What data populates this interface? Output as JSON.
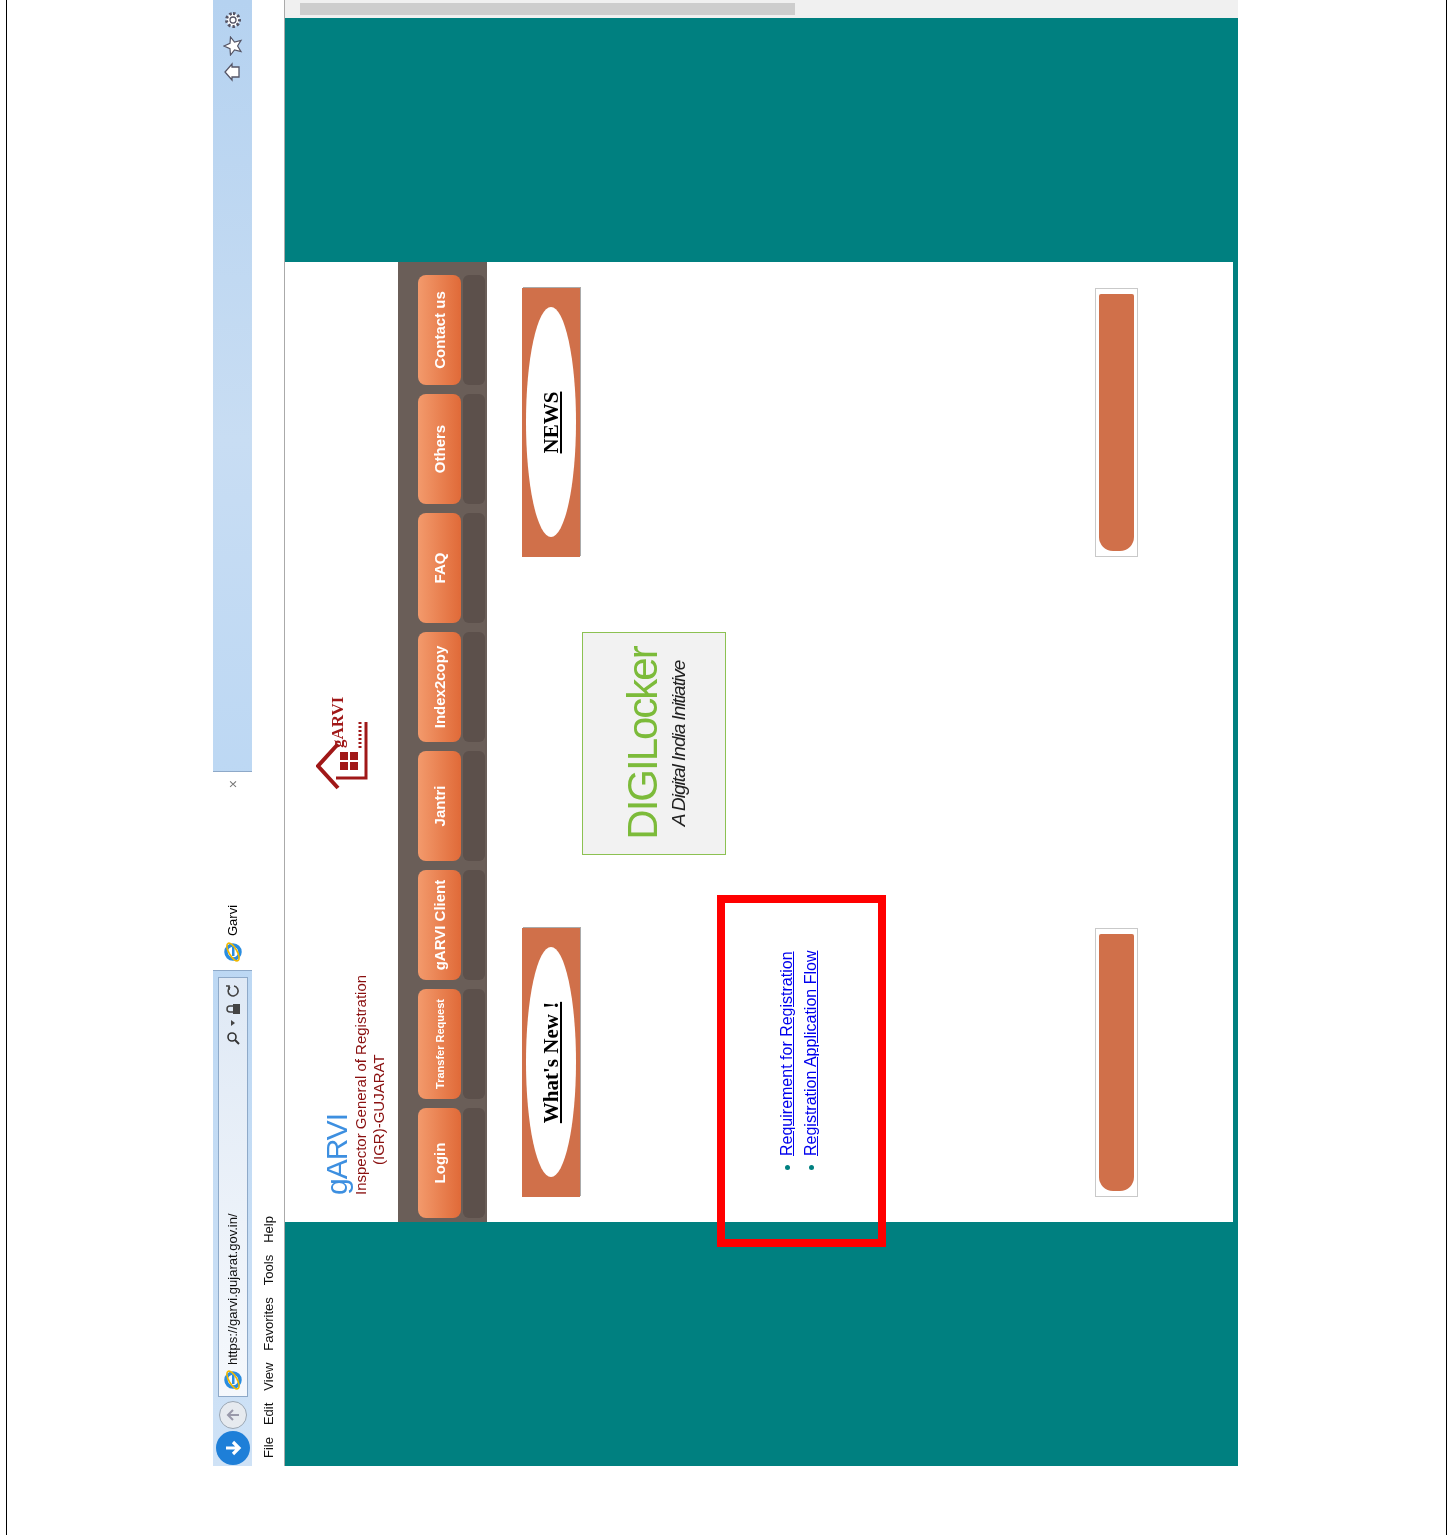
{
  "browser": {
    "url": "https://garvi.gujarat.gov.in/",
    "tab_title": "Garvi",
    "tab_close": "×",
    "menu": [
      "File",
      "Edit",
      "View",
      "Favorites",
      "Tools",
      "Help"
    ]
  },
  "site": {
    "brand": "gARVI",
    "org_line1": "Inspector General of Registration",
    "org_line2": "(IGR)-GUJARAT",
    "logo_text": "gARVI"
  },
  "nav": [
    {
      "label": "Login"
    },
    {
      "label": "Transfer Request"
    },
    {
      "label": "gARVI Client"
    },
    {
      "label": "Jantri"
    },
    {
      "label": "Index2copy"
    },
    {
      "label": "FAQ"
    },
    {
      "label": "Others"
    },
    {
      "label": "Contact us"
    }
  ],
  "panels": [
    {
      "title": "What's New !"
    },
    {
      "title": "NEWS"
    }
  ],
  "digilocker": {
    "name": "DIGILocker",
    "tagline": "A Digital India Initiative"
  },
  "links": [
    "Requirement for Registration",
    "Registration Application Flow"
  ]
}
